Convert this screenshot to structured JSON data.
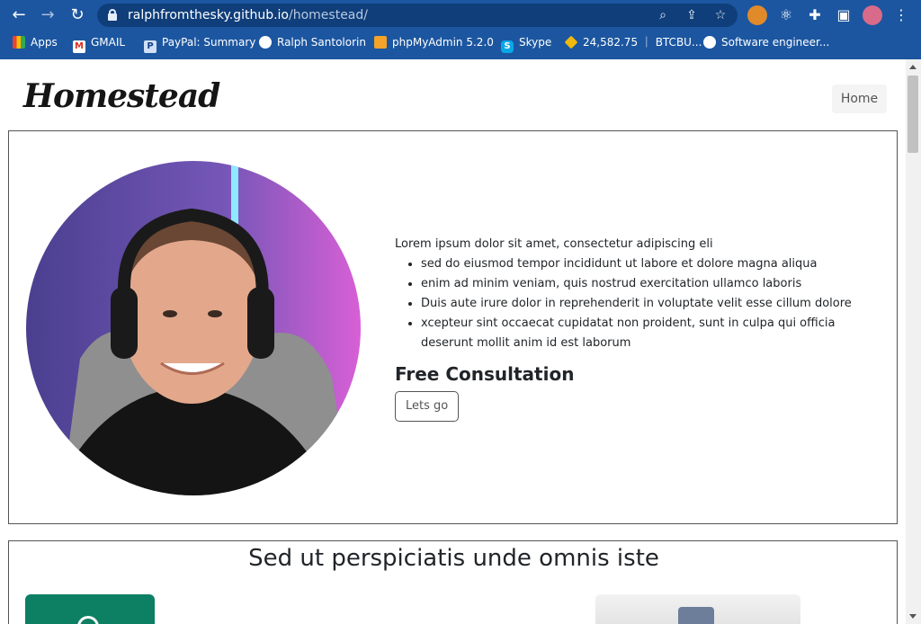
{
  "browser": {
    "url_host": "ralphfromthesky.github.io",
    "url_path": "/homestead/",
    "bookmarks": [
      {
        "label": "Apps",
        "icon": "apps-grid-icon"
      },
      {
        "label": "GMAIL",
        "icon": "gmail-icon"
      },
      {
        "label": "PayPal: Summary",
        "icon": "paypal-icon"
      },
      {
        "label": "Ralph Santolorin",
        "icon": "globe-icon"
      },
      {
        "label": "phpMyAdmin 5.2.0",
        "icon": "phpmyadmin-icon"
      },
      {
        "label": "Skype",
        "icon": "skype-icon"
      },
      {
        "label": "24,582.75 ｜ BTCBU...",
        "icon": "binance-icon"
      },
      {
        "label": "Software engineer...",
        "icon": "globe-icon"
      }
    ]
  },
  "site": {
    "logo": "Homestead",
    "nav_home": "Home"
  },
  "hero": {
    "intro": "Lorem ipsum dolor sit amet, consectetur adipiscing eli",
    "bullets": [
      "sed do eiusmod tempor incididunt ut labore et dolore magna aliqua",
      "enim ad minim veniam, quis nostrud exercitation ullamco laboris",
      "Duis aute irure dolor in reprehenderit in voluptate velit esse cillum dolore",
      "xcepteur sint occaecat cupidatat non proident, sunt in culpa qui officia deserunt mollit anim id est laborum"
    ],
    "heading": "Free Consultation",
    "button": "Lets go"
  },
  "section2": {
    "heading": "Sed ut perspiciatis unde omnis iste"
  }
}
